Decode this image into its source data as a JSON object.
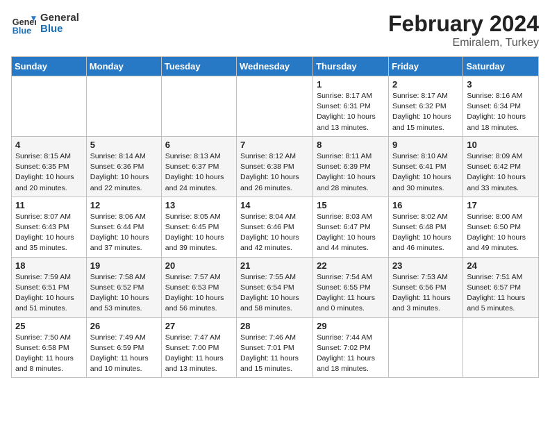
{
  "header": {
    "logo_general": "General",
    "logo_blue": "Blue",
    "month_year": "February 2024",
    "location": "Emiralem, Turkey"
  },
  "days_of_week": [
    "Sunday",
    "Monday",
    "Tuesday",
    "Wednesday",
    "Thursday",
    "Friday",
    "Saturday"
  ],
  "weeks": [
    [
      {
        "day": "",
        "text": ""
      },
      {
        "day": "",
        "text": ""
      },
      {
        "day": "",
        "text": ""
      },
      {
        "day": "",
        "text": ""
      },
      {
        "day": "1",
        "text": "Sunrise: 8:17 AM\nSunset: 6:31 PM\nDaylight: 10 hours\nand 13 minutes."
      },
      {
        "day": "2",
        "text": "Sunrise: 8:17 AM\nSunset: 6:32 PM\nDaylight: 10 hours\nand 15 minutes."
      },
      {
        "day": "3",
        "text": "Sunrise: 8:16 AM\nSunset: 6:34 PM\nDaylight: 10 hours\nand 18 minutes."
      }
    ],
    [
      {
        "day": "4",
        "text": "Sunrise: 8:15 AM\nSunset: 6:35 PM\nDaylight: 10 hours\nand 20 minutes."
      },
      {
        "day": "5",
        "text": "Sunrise: 8:14 AM\nSunset: 6:36 PM\nDaylight: 10 hours\nand 22 minutes."
      },
      {
        "day": "6",
        "text": "Sunrise: 8:13 AM\nSunset: 6:37 PM\nDaylight: 10 hours\nand 24 minutes."
      },
      {
        "day": "7",
        "text": "Sunrise: 8:12 AM\nSunset: 6:38 PM\nDaylight: 10 hours\nand 26 minutes."
      },
      {
        "day": "8",
        "text": "Sunrise: 8:11 AM\nSunset: 6:39 PM\nDaylight: 10 hours\nand 28 minutes."
      },
      {
        "day": "9",
        "text": "Sunrise: 8:10 AM\nSunset: 6:41 PM\nDaylight: 10 hours\nand 30 minutes."
      },
      {
        "day": "10",
        "text": "Sunrise: 8:09 AM\nSunset: 6:42 PM\nDaylight: 10 hours\nand 33 minutes."
      }
    ],
    [
      {
        "day": "11",
        "text": "Sunrise: 8:07 AM\nSunset: 6:43 PM\nDaylight: 10 hours\nand 35 minutes."
      },
      {
        "day": "12",
        "text": "Sunrise: 8:06 AM\nSunset: 6:44 PM\nDaylight: 10 hours\nand 37 minutes."
      },
      {
        "day": "13",
        "text": "Sunrise: 8:05 AM\nSunset: 6:45 PM\nDaylight: 10 hours\nand 39 minutes."
      },
      {
        "day": "14",
        "text": "Sunrise: 8:04 AM\nSunset: 6:46 PM\nDaylight: 10 hours\nand 42 minutes."
      },
      {
        "day": "15",
        "text": "Sunrise: 8:03 AM\nSunset: 6:47 PM\nDaylight: 10 hours\nand 44 minutes."
      },
      {
        "day": "16",
        "text": "Sunrise: 8:02 AM\nSunset: 6:48 PM\nDaylight: 10 hours\nand 46 minutes."
      },
      {
        "day": "17",
        "text": "Sunrise: 8:00 AM\nSunset: 6:50 PM\nDaylight: 10 hours\nand 49 minutes."
      }
    ],
    [
      {
        "day": "18",
        "text": "Sunrise: 7:59 AM\nSunset: 6:51 PM\nDaylight: 10 hours\nand 51 minutes."
      },
      {
        "day": "19",
        "text": "Sunrise: 7:58 AM\nSunset: 6:52 PM\nDaylight: 10 hours\nand 53 minutes."
      },
      {
        "day": "20",
        "text": "Sunrise: 7:57 AM\nSunset: 6:53 PM\nDaylight: 10 hours\nand 56 minutes."
      },
      {
        "day": "21",
        "text": "Sunrise: 7:55 AM\nSunset: 6:54 PM\nDaylight: 10 hours\nand 58 minutes."
      },
      {
        "day": "22",
        "text": "Sunrise: 7:54 AM\nSunset: 6:55 PM\nDaylight: 11 hours\nand 0 minutes."
      },
      {
        "day": "23",
        "text": "Sunrise: 7:53 AM\nSunset: 6:56 PM\nDaylight: 11 hours\nand 3 minutes."
      },
      {
        "day": "24",
        "text": "Sunrise: 7:51 AM\nSunset: 6:57 PM\nDaylight: 11 hours\nand 5 minutes."
      }
    ],
    [
      {
        "day": "25",
        "text": "Sunrise: 7:50 AM\nSunset: 6:58 PM\nDaylight: 11 hours\nand 8 minutes."
      },
      {
        "day": "26",
        "text": "Sunrise: 7:49 AM\nSunset: 6:59 PM\nDaylight: 11 hours\nand 10 minutes."
      },
      {
        "day": "27",
        "text": "Sunrise: 7:47 AM\nSunset: 7:00 PM\nDaylight: 11 hours\nand 13 minutes."
      },
      {
        "day": "28",
        "text": "Sunrise: 7:46 AM\nSunset: 7:01 PM\nDaylight: 11 hours\nand 15 minutes."
      },
      {
        "day": "29",
        "text": "Sunrise: 7:44 AM\nSunset: 7:02 PM\nDaylight: 11 hours\nand 18 minutes."
      },
      {
        "day": "",
        "text": ""
      },
      {
        "day": "",
        "text": ""
      }
    ]
  ]
}
